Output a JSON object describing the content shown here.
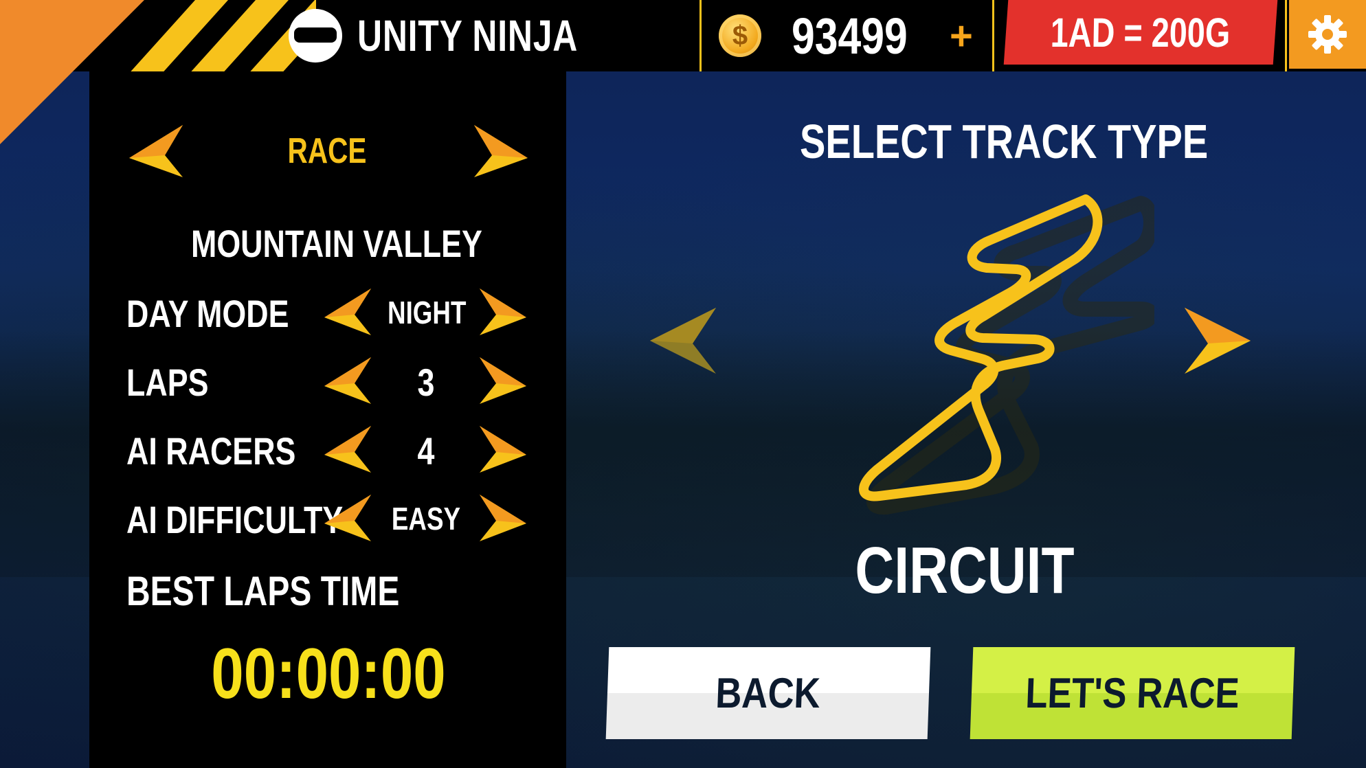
{
  "header": {
    "player_name": "UNITY NINJA",
    "coins": "93499",
    "coin_symbol": "$",
    "add_coins_label": "+",
    "ad_offer_label": "1AD = 200G"
  },
  "left_panel": {
    "mode_label": "RACE",
    "track_name": "MOUNTAIN VALLEY",
    "settings": [
      {
        "label": "DAY MODE",
        "value": "NIGHT"
      },
      {
        "label": "LAPS",
        "value": "3"
      },
      {
        "label": "AI RACERS",
        "value": "4"
      },
      {
        "label": "AI DIFFICULTY",
        "value": "EASY"
      }
    ],
    "best_time_label": "BEST LAPS TIME",
    "best_time_value": "00:00:00"
  },
  "track_select": {
    "title": "SELECT TRACK TYPE",
    "track_type": "CIRCUIT"
  },
  "buttons": {
    "back": "BACK",
    "race": "LET'S RACE"
  },
  "colors": {
    "accent_yellow": "#f7c21b",
    "ad_red": "#e3312c",
    "settings_orange": "#f39a20",
    "race_green": "#c9ec3e"
  }
}
